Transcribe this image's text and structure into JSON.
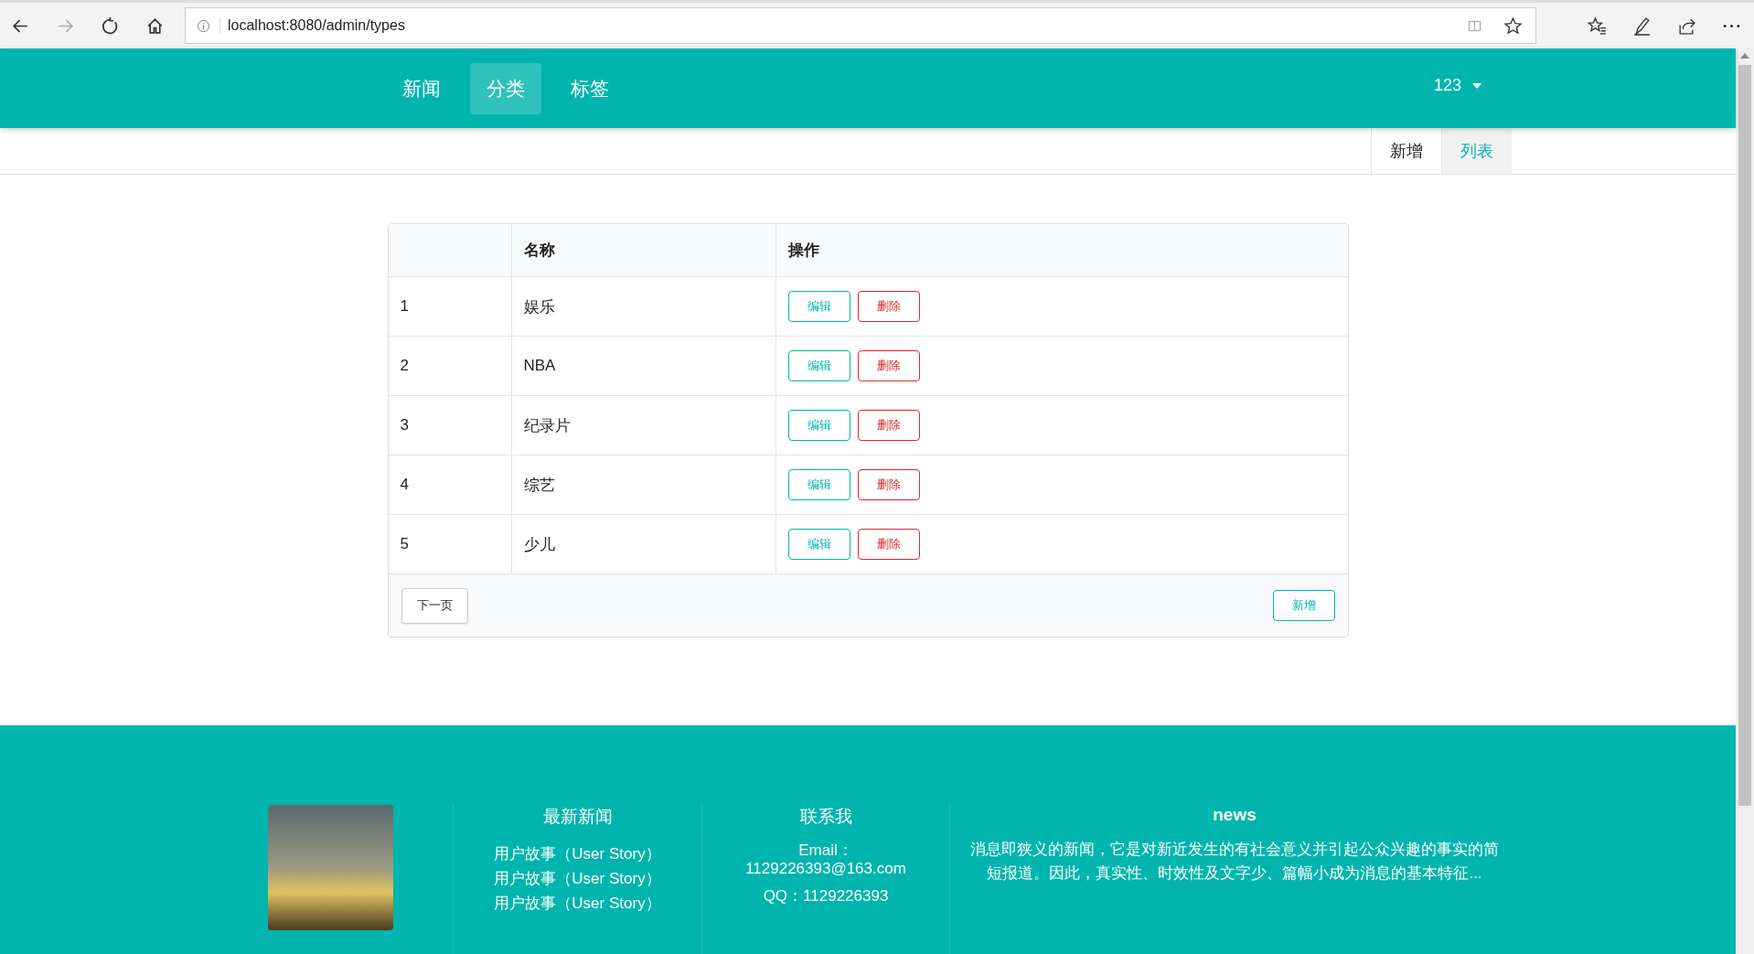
{
  "browser": {
    "url": "localhost:8080/admin/types"
  },
  "nav": {
    "items": [
      {
        "label": "新闻",
        "selected": false
      },
      {
        "label": "分类",
        "selected": true
      },
      {
        "label": "标签",
        "selected": false
      }
    ],
    "user": "123"
  },
  "submenu": {
    "items": [
      {
        "label": "新增",
        "selected": false
      },
      {
        "label": "列表",
        "selected": true
      }
    ]
  },
  "table": {
    "columns": [
      "名称",
      "操作"
    ],
    "rows": [
      {
        "index": "1",
        "name": "娱乐",
        "actions": [
          {
            "label": "编辑",
            "kind": "edit"
          },
          {
            "label": "删除",
            "kind": "delete"
          }
        ]
      },
      {
        "index": "2",
        "name": "NBA",
        "actions": [
          {
            "label": "编辑",
            "kind": "edit"
          },
          {
            "label": "删除",
            "kind": "delete"
          }
        ]
      },
      {
        "index": "3",
        "name": "纪录片",
        "actions": [
          {
            "label": "编辑",
            "kind": "edit"
          },
          {
            "label": "删除",
            "kind": "delete"
          }
        ]
      },
      {
        "index": "4",
        "name": "综艺",
        "actions": [
          {
            "label": "编辑",
            "kind": "edit"
          },
          {
            "label": "删除",
            "kind": "delete"
          }
        ]
      },
      {
        "index": "5",
        "name": "少儿",
        "actions": [
          {
            "label": "编辑",
            "kind": "edit"
          },
          {
            "label": "删除",
            "kind": "delete"
          }
        ]
      }
    ],
    "pagination": {
      "next": "下一页",
      "add": "新增"
    }
  },
  "footer": {
    "news_title": "最新新闻",
    "news_links": [
      "用户故事（User Story）",
      "用户故事（User Story）",
      "用户故事（User Story）"
    ],
    "contact_title": "联系我",
    "contact_lines": [
      "Email：",
      "1129226393@163.com",
      "QQ：1129226393"
    ],
    "about_title": "news",
    "about_text": "消息即狭义的新闻，它是对新近发生的有社会意义并引起公众兴趣的事实的简短报道。因此，真实性、时效性及文字少、篇幅小成为消息的基本特征..."
  }
}
